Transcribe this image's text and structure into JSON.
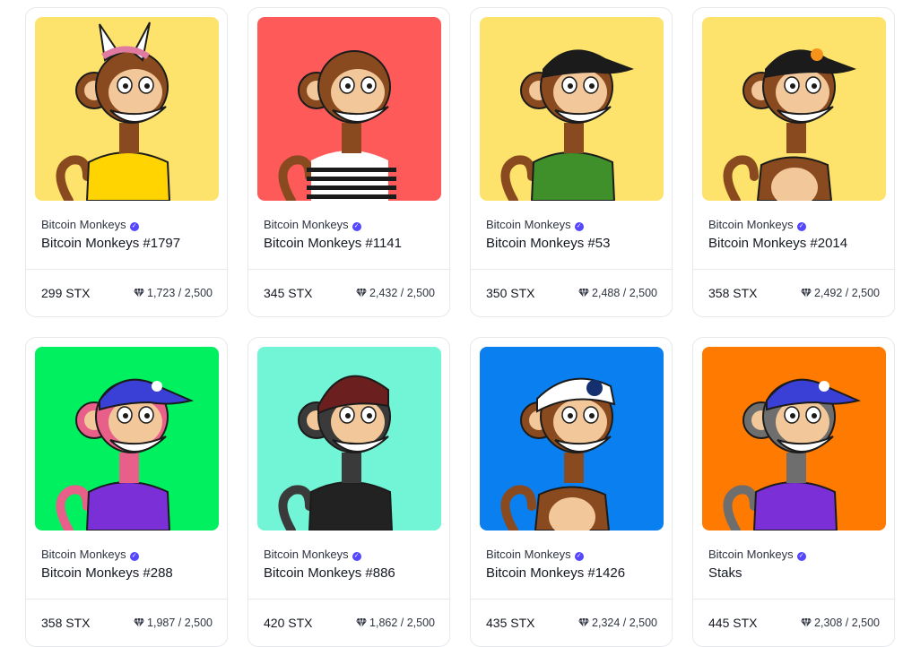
{
  "collection_label": "Bitcoin Monkeys",
  "cards": [
    {
      "name": "Bitcoin Monkeys #1797",
      "price": "299 STX",
      "rank": "1,723 / 2,500",
      "bg": "#fde36b",
      "shirt": "#ffd400",
      "fur": "#8a4a1f",
      "hat": "bunny"
    },
    {
      "name": "Bitcoin Monkeys #1141",
      "price": "345 STX",
      "rank": "2,432 / 2,500",
      "bg": "#ff5a5a",
      "shirt": "stripes",
      "fur": "#8a4a1f",
      "hat": "none"
    },
    {
      "name": "Bitcoin Monkeys #53",
      "price": "350 STX",
      "rank": "2,488 / 2,500",
      "bg": "#fde36b",
      "shirt": "#3f8f2a",
      "fur": "#8a4a1f",
      "hat": "black"
    },
    {
      "name": "Bitcoin Monkeys #2014",
      "price": "358 STX",
      "rank": "2,492 / 2,500",
      "bg": "#fde36b",
      "shirt": "none",
      "fur": "#8a4a1f",
      "hat": "black-btc"
    },
    {
      "name": "Bitcoin Monkeys #288",
      "price": "358 STX",
      "rank": "1,987 / 2,500",
      "bg": "#00f060",
      "shirt": "#7b2fd6",
      "fur": "#e8608a",
      "hat": "blue"
    },
    {
      "name": "Bitcoin Monkeys #886",
      "price": "420 STX",
      "rank": "1,862 / 2,500",
      "bg": "#72f5d6",
      "shirt": "#222222",
      "fur": "#3a3a3a",
      "hat": "beanie"
    },
    {
      "name": "Bitcoin Monkeys #1426",
      "price": "435 STX",
      "rank": "2,324 / 2,500",
      "bg": "#0a7ff0",
      "shirt": "none",
      "fur": "#8a4a1f",
      "hat": "sailor"
    },
    {
      "name": "Staks",
      "price": "445 STX",
      "rank": "2,308 / 2,500",
      "bg": "#ff7a00",
      "shirt": "#7b2fd6",
      "fur": "#6e6e6e",
      "hat": "blue"
    }
  ],
  "colors": {
    "verified": "#5546ff",
    "border": "#e6e8ec"
  }
}
